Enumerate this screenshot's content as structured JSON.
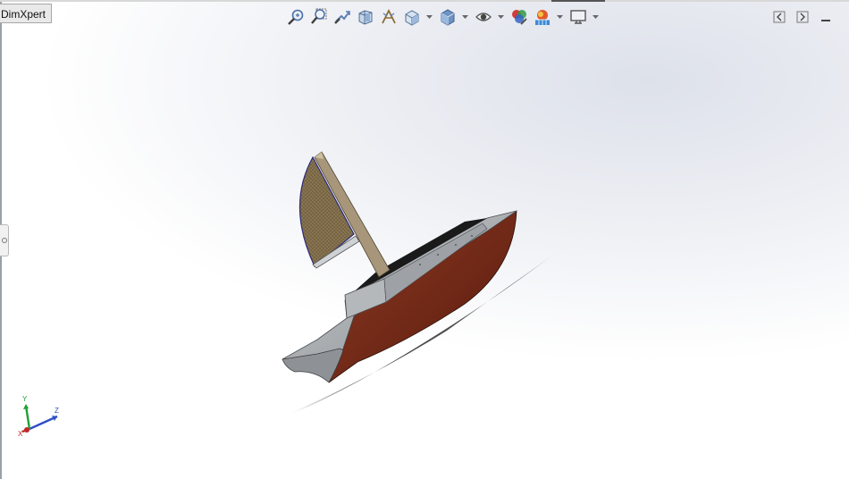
{
  "tabs": {
    "dimxpert_label": "DimXpert"
  },
  "heads_up_toolbar": {
    "icons": [
      "zoom-to-fit-icon",
      "zoom-to-area-icon",
      "previous-view-icon",
      "section-view-icon",
      "dynamic-annotation-icon",
      "view-orientation-icon",
      "display-style-icon",
      "hide-show-items-icon",
      "edit-appearance-icon",
      "apply-scene-icon",
      "view-settings-icon"
    ]
  },
  "window_controls": {
    "icons": [
      "collapse-left-icon",
      "expand-right-icon",
      "minimize-icon"
    ]
  },
  "triad": {
    "x": "X",
    "y": "Y",
    "z": "Z"
  },
  "colors": {
    "hull": "#7d2f1c",
    "deck": "#a9adb1",
    "sail": "#8a7550",
    "mast": "#9c8a6c",
    "triad_x": "#c0282a",
    "triad_y": "#1f9e34",
    "triad_z": "#2f4fc4"
  }
}
